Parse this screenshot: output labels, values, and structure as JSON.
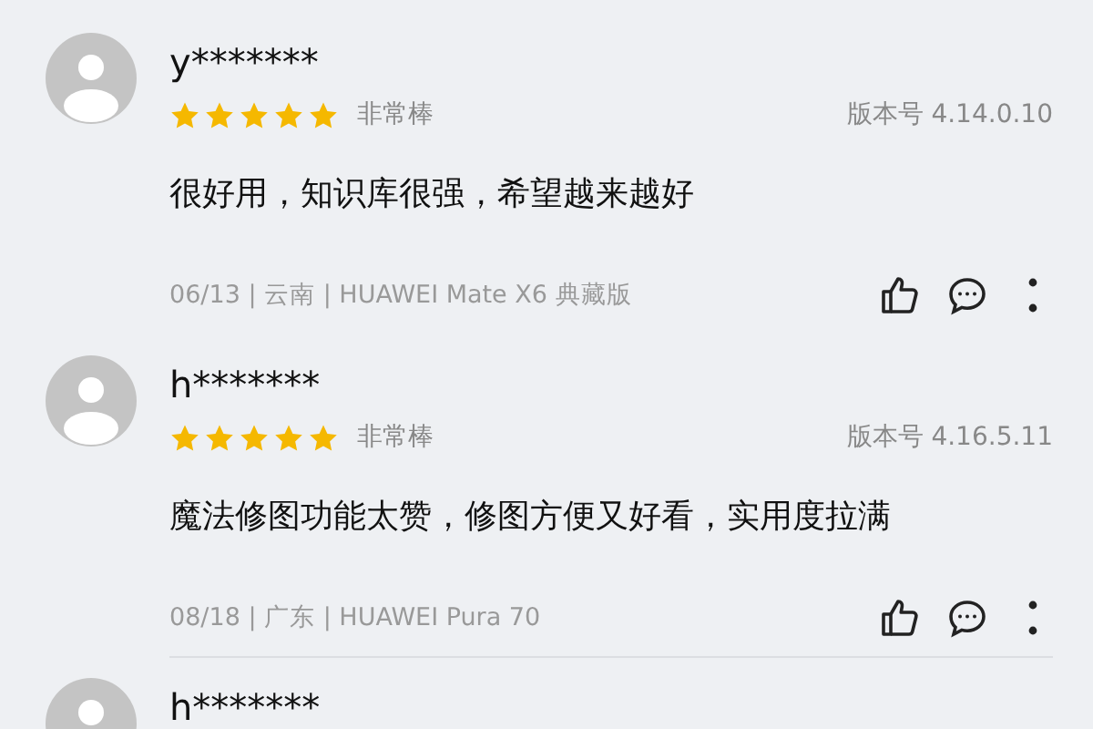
{
  "reviews": [
    {
      "user": "y*******",
      "stars": 5,
      "rating_label": "非常棒",
      "version": "版本号 4.14.0.10",
      "text": "很好用，知识库很强，希望越来越好",
      "meta": "06/13 | 云南 | HUAWEI Mate X6 典藏版"
    },
    {
      "user": "h*******",
      "stars": 5,
      "rating_label": "非常棒",
      "version": "版本号 4.16.5.11",
      "text": "魔法修图功能太赞，修图方便又好看，实用度拉满",
      "meta": "08/18 | 广东 | HUAWEI Pura 70"
    },
    {
      "user": "h*******"
    }
  ]
}
